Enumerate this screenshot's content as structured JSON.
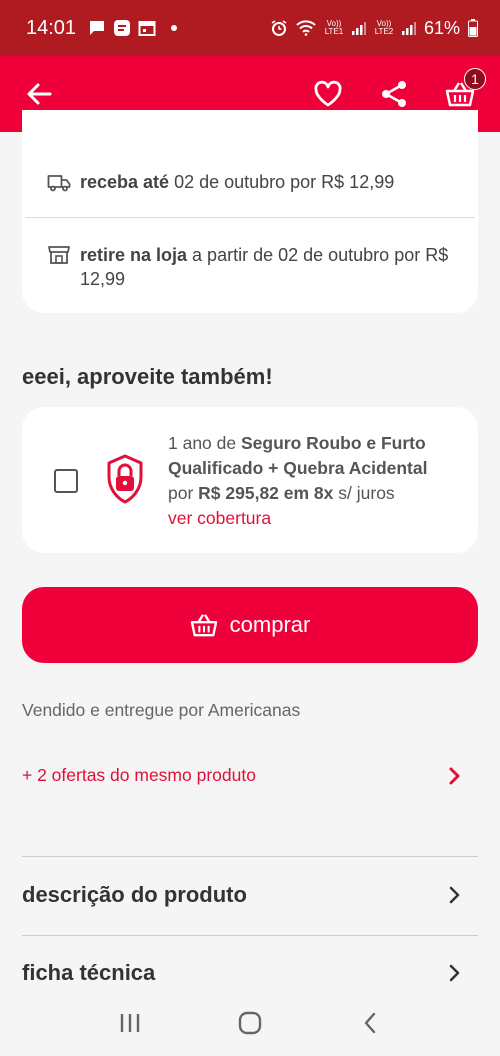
{
  "status_bar": {
    "time": "14:01",
    "net1": "Vo)) LTE1",
    "net2": "Vo)) LTE2",
    "battery": "61%"
  },
  "app_bar": {
    "cart_count": "1"
  },
  "delivery": {
    "ship_bold": "receba até",
    "ship_text": " 02 de outubro por R$ 12,99",
    "pickup_bold": "retire na loja",
    "pickup_text": " a partir de 02 de outubro por R$ 12,99"
  },
  "upsell": {
    "title": "eeei, aproveite também!",
    "prefix": "1 ano de ",
    "product": "Seguro Roubo e Furto Qualificado + Quebra Acidental",
    "price_prefix": "por ",
    "price": "R$ 295,82 em 8x",
    "price_suffix": " s/ juros",
    "link": "ver cobertura"
  },
  "buy_button": {
    "label": "comprar"
  },
  "seller": {
    "text": "Vendido e entregue por Americanas"
  },
  "offers": {
    "label": "+ 2 ofertas do mesmo produto"
  },
  "sections": {
    "description": "descrição do produto",
    "specs": "ficha técnica"
  },
  "colors": {
    "brand": "#f0003a",
    "status_bar": "#b01b22",
    "link": "#e0103a"
  }
}
